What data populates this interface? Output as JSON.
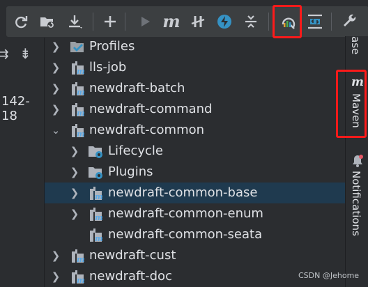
{
  "left_panel": {
    "coordinate_text": "142-18"
  },
  "toolbar": {
    "buttons": [
      {
        "icon": "reload-icon"
      },
      {
        "icon": "generate-sources-icon"
      },
      {
        "icon": "download-icon"
      },
      {
        "icon": "add-icon"
      },
      {
        "icon": "run-icon"
      },
      {
        "icon": "maven-goal-icon",
        "label": "m"
      },
      {
        "icon": "toggle-offline-icon"
      },
      {
        "icon": "skip-tests-icon"
      },
      {
        "icon": "collapse-all-icon"
      },
      {
        "icon": "analyze-dependencies-icon",
        "highlighted": true
      },
      {
        "icon": "show-diagram-icon"
      },
      {
        "icon": "settings-wrench-icon"
      }
    ]
  },
  "tree": {
    "items": [
      {
        "label": "Profiles",
        "icon": "profiles-icon",
        "expanded": false,
        "level": 0
      },
      {
        "label": "lls-job",
        "icon": "maven-module-icon",
        "expanded": false,
        "level": 0
      },
      {
        "label": "newdraft-batch",
        "icon": "maven-module-icon",
        "expanded": false,
        "level": 0
      },
      {
        "label": "newdraft-command",
        "icon": "maven-module-icon",
        "expanded": false,
        "level": 0
      },
      {
        "label": "newdraft-common",
        "icon": "maven-module-icon",
        "expanded": true,
        "level": 0
      },
      {
        "label": "Lifecycle",
        "icon": "folder-gear-icon",
        "expanded": false,
        "level": 1
      },
      {
        "label": "Plugins",
        "icon": "folder-gear-icon",
        "expanded": false,
        "level": 1
      },
      {
        "label": "newdraft-common-base",
        "icon": "maven-module-icon",
        "expanded": false,
        "level": 1,
        "selected": true
      },
      {
        "label": "newdraft-common-enum",
        "icon": "maven-module-icon",
        "expanded": false,
        "level": 1
      },
      {
        "label": "newdraft-common-seata",
        "icon": "maven-module-icon",
        "expanded": false,
        "level": 1
      },
      {
        "label": "newdraft-cust",
        "icon": "maven-module-icon",
        "expanded": false,
        "level": 0
      },
      {
        "label": "newdraft-doc",
        "icon": "maven-module-icon",
        "expanded": false,
        "level": 0
      }
    ]
  },
  "right_sidebar": {
    "top_tab_label": "ase",
    "maven_tab": {
      "label": "Maven",
      "icon": "maven-m-icon",
      "highlighted": true
    },
    "notifications_tab": {
      "label": "Notifications",
      "icon": "bell-icon"
    }
  },
  "watermark": "CSDN @Jehome",
  "colors": {
    "accent_highlight": "#ff1a1a",
    "selection": "#1f3a4f",
    "module_icon_blue": "#5aa9e6"
  }
}
